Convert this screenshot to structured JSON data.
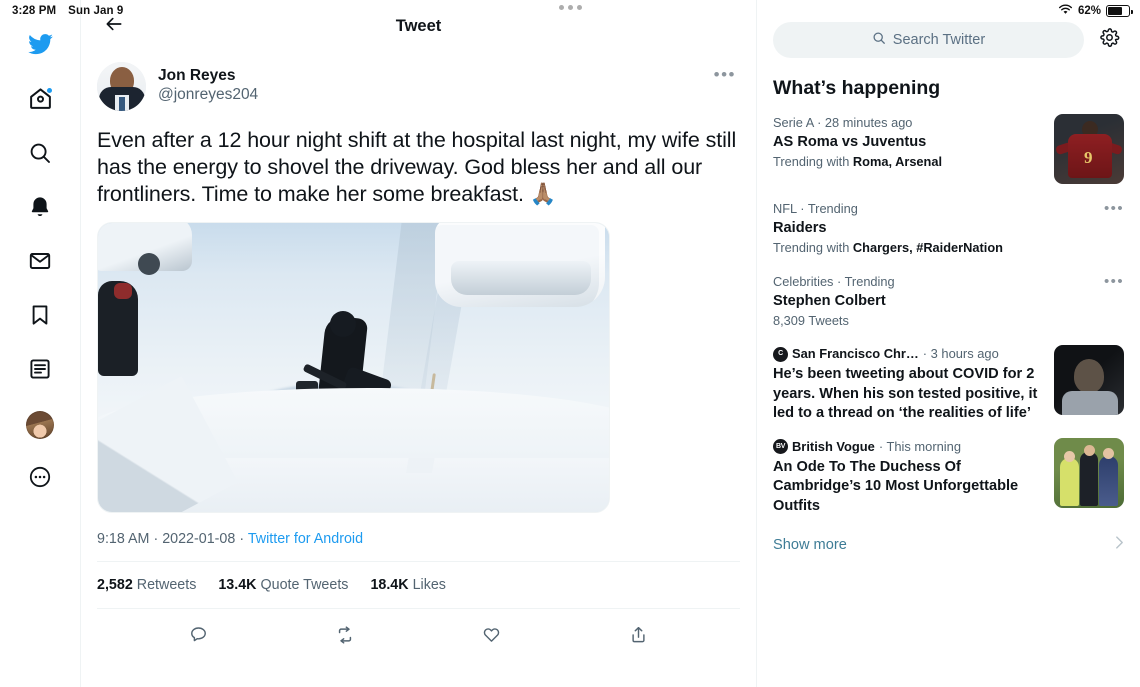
{
  "status_bar": {
    "time": "3:28 PM",
    "date": "Sun Jan 9",
    "battery_percent": "62%",
    "wifi_icon": "wifi-icon",
    "battery_icon": "battery-icon"
  },
  "rail": {
    "items": [
      {
        "name": "twitter-logo",
        "icon": "twitter-bird-icon",
        "badge": false
      },
      {
        "name": "home",
        "icon": "home-icon",
        "badge": true
      },
      {
        "name": "explore",
        "icon": "search-icon",
        "badge": false
      },
      {
        "name": "notifications",
        "icon": "bell-icon",
        "badge": false
      },
      {
        "name": "messages",
        "icon": "envelope-icon",
        "badge": false
      },
      {
        "name": "bookmarks",
        "icon": "bookmark-icon",
        "badge": false
      },
      {
        "name": "lists",
        "icon": "list-icon",
        "badge": false
      },
      {
        "name": "profile",
        "icon": "avatar-icon",
        "badge": false
      },
      {
        "name": "more",
        "icon": "more-circle-icon",
        "badge": false
      }
    ]
  },
  "center": {
    "back_icon": "back-arrow-icon",
    "title": "Tweet",
    "tweet": {
      "author_name": "Jon Reyes",
      "author_handle": "@jonreyes204",
      "overflow_icon": "more-horizontal-icon",
      "text": "Even after a 12 hour night shift at the hospital last night, my wife still has the energy to shovel the driveway. God bless her and all our frontliners. Time to make her some breakfast. 🙏🏽",
      "media_alt": "Person shoveling snow from a driveway beside snow-covered cars",
      "time": "9:18 AM",
      "date": "2022-01-08",
      "source": "Twitter for Android",
      "meta_separator": "·",
      "stats": [
        {
          "count": "2,582",
          "label": "Retweets"
        },
        {
          "count": "13.4K",
          "label": "Quote Tweets"
        },
        {
          "count": "18.4K",
          "label": "Likes"
        }
      ],
      "actions": [
        {
          "name": "reply-button",
          "icon": "comment-icon"
        },
        {
          "name": "retweet-button",
          "icon": "retweet-icon"
        },
        {
          "name": "like-button",
          "icon": "heart-icon"
        },
        {
          "name": "share-button",
          "icon": "share-icon"
        }
      ]
    }
  },
  "right": {
    "search": {
      "placeholder": "Search Twitter",
      "icon": "search-icon"
    },
    "settings_icon": "gear-icon",
    "panel_title": "What’s happening",
    "trends": [
      {
        "category": "Serie A · 28 minutes ago",
        "name": "AS Roma vs Juventus",
        "sub_prefix": "Trending with ",
        "sub_bold": "Roma, Arsenal",
        "thumb": "soccer",
        "has_dots": false
      },
      {
        "category": "NFL · Trending",
        "name": "Raiders",
        "sub_prefix": "Trending with ",
        "sub_bold": "Chargers, #RaiderNation",
        "thumb": "none",
        "has_dots": true
      },
      {
        "category": "Celebrities · Trending",
        "name": "Stephen Colbert",
        "sub_prefix": "8,309 Tweets",
        "sub_bold": "",
        "thumb": "none",
        "has_dots": true
      }
    ],
    "news": [
      {
        "logo_text": "C",
        "source": "San Francisco Chr…",
        "time": "· 3 hours ago",
        "title": "He’s been tweeting about COVID for 2 years. When his son tested positive, it led to a thread on ‘the realities of life’",
        "thumb": "dark-portrait"
      },
      {
        "logo_text": "BV",
        "source": "British Vogue",
        "time": "· This morning",
        "title": "An Ode To The Duchess Of Cambridge’s 10 Most Unforgettable Outfits",
        "thumb": "royal"
      }
    ],
    "show_more": {
      "label": "Show more",
      "chevron": "chevron-right-icon"
    }
  },
  "colors": {
    "accent": "#1d9bf0",
    "link": "#3e7c96",
    "muted": "#536471",
    "text": "#0f1419",
    "divider": "#eff3f4"
  }
}
